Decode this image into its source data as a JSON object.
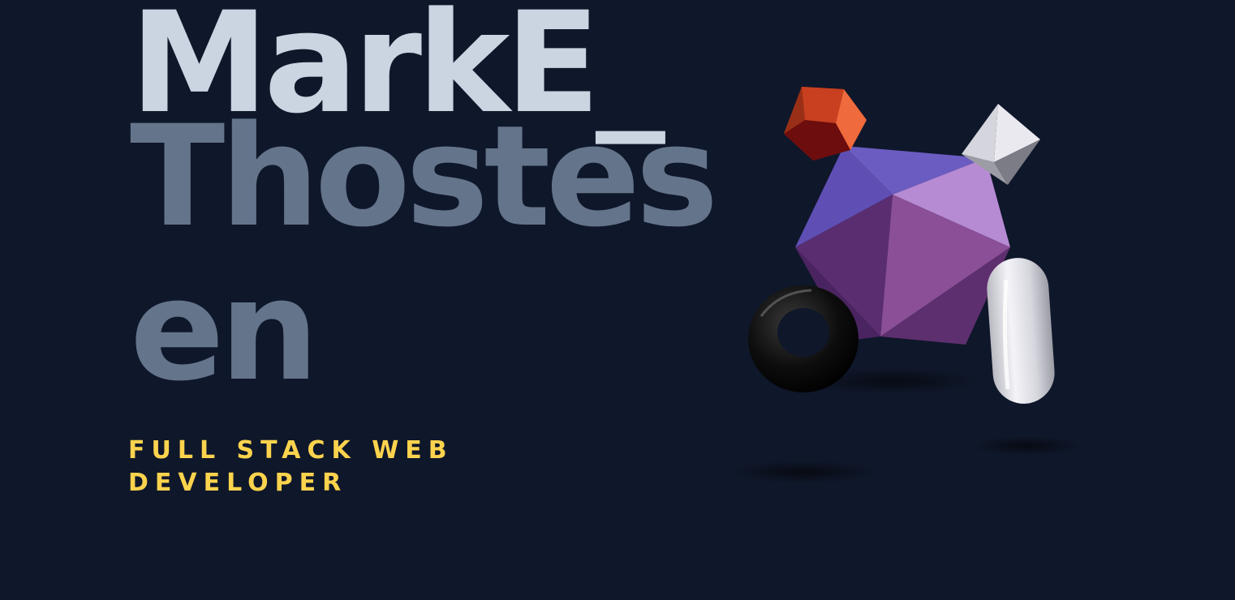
{
  "hero": {
    "name_first": "MarkE_",
    "name_last_line1": "Thostes",
    "name_last_line2": "en",
    "role_line1": "FULL STACK WEB",
    "role_line2": "DEVELOPER"
  },
  "scene": {
    "shapes": [
      "dodecahedron",
      "octahedron",
      "icosahedron",
      "torus",
      "capsule"
    ]
  },
  "colors": {
    "background": "#0f172a",
    "name_first": "#cbd5e1",
    "name_last": "#64748b",
    "role": "#fcd34d",
    "icosahedron": "#8b5cc4",
    "dodecahedron": "#d84a26",
    "octahedron": "#c8c8d0",
    "torus": "#111111",
    "capsule": "#e5e5ea"
  }
}
